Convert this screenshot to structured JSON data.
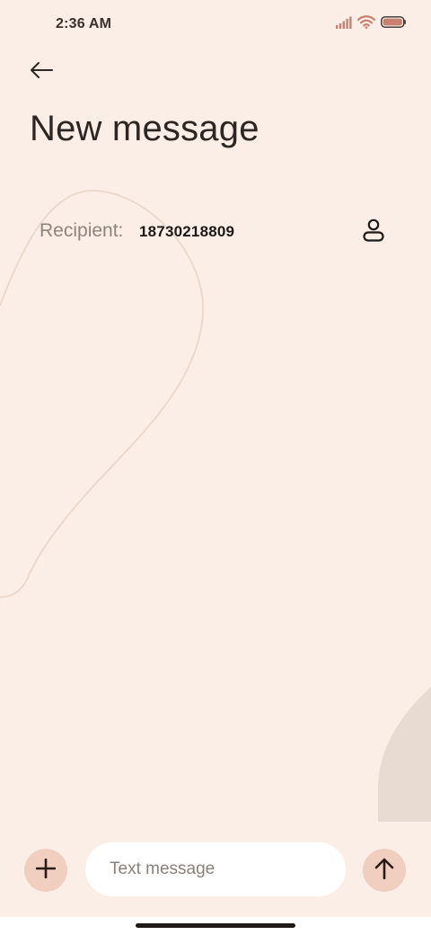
{
  "status_bar": {
    "time": "2:36 AM",
    "icons": [
      "signal-icon",
      "wifi-icon",
      "battery-icon"
    ]
  },
  "header": {
    "back_icon": "arrow-left-icon",
    "title": "New message"
  },
  "recipient": {
    "label": "Recipient:",
    "value": "18730218809",
    "contact_icon": "contact-person-icon"
  },
  "composer": {
    "add_icon": "plus-icon",
    "placeholder": "Text message",
    "value": "",
    "send_icon": "arrow-up-icon"
  },
  "colors": {
    "background": "#fbeee6",
    "accent": "#f0cfc0",
    "battery": "#c9806e"
  }
}
